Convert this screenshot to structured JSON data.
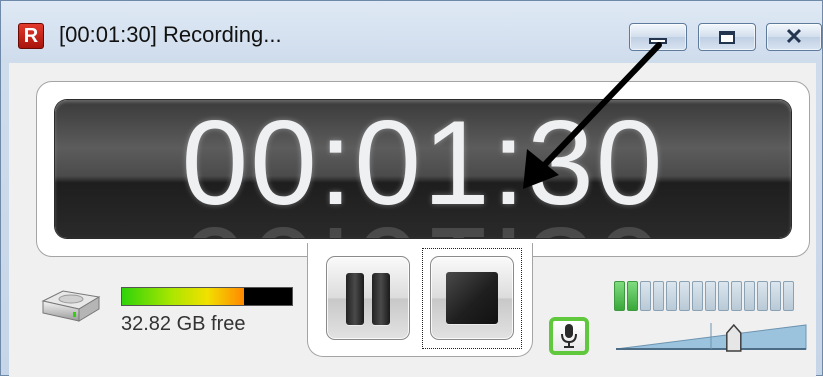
{
  "window": {
    "title": "[00:01:30] Recording...",
    "app_icon_letter": "R"
  },
  "timer": {
    "elapsed": "00:01:30"
  },
  "controls": {
    "pause": "pause-icon",
    "stop": "stop-icon",
    "focused": "stop-button"
  },
  "disk": {
    "free_text": "32.82 GB free",
    "used_fraction": 0.72,
    "icon": "hard-drive-icon"
  },
  "audio": {
    "mic_icon": "microphone-icon",
    "mic_enabled_color": "#5fc83c",
    "level_segments_total": 14,
    "level_segments_lit": 2,
    "volume_fraction": 0.62
  },
  "colors": {
    "app_icon_red": "#c0201a",
    "titlebar": "#dfe9f5",
    "timer_bg": "#3a3a3a",
    "timer_text": "#eef0f2"
  }
}
